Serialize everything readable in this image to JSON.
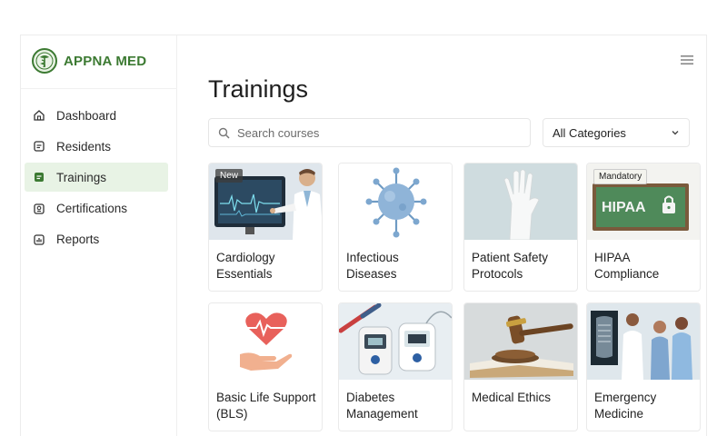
{
  "brand": {
    "name": "APPNA MED",
    "accent": "#3c7a32"
  },
  "sidebar": {
    "items": [
      {
        "label": "Dashboard",
        "icon": "home-icon",
        "active": false
      },
      {
        "label": "Residents",
        "icon": "id-card-icon",
        "active": false
      },
      {
        "label": "Trainings",
        "icon": "book-icon",
        "active": true
      },
      {
        "label": "Certifications",
        "icon": "certificate-icon",
        "active": false
      },
      {
        "label": "Reports",
        "icon": "chart-icon",
        "active": false
      }
    ]
  },
  "main": {
    "title": "Trainings",
    "search": {
      "placeholder": "Search courses",
      "value": ""
    },
    "category": {
      "selected": "All Categories"
    }
  },
  "courses": [
    {
      "title": "Cardiology Essentials",
      "badge": "New",
      "image": "doctor-pointing-at-ecg-monitor"
    },
    {
      "title": "Infectious Diseases",
      "badge": "",
      "image": "virus-particle"
    },
    {
      "title": "Patient Safety Protocols",
      "badge": "",
      "image": "gloved-hand"
    },
    {
      "title": "HIPAA Compliance",
      "badge": "Mandatory",
      "image": "hipaa-chalkboard-with-lock",
      "image_text": "HIPAA"
    },
    {
      "title": "Basic Life Support (BLS)",
      "badge": "",
      "image": "heart-in-hand"
    },
    {
      "title": "Diabetes Management",
      "badge": "",
      "image": "glucose-meters"
    },
    {
      "title": "Medical Ethics",
      "badge": "",
      "image": "gavel-on-book"
    },
    {
      "title": "Emergency Medicine",
      "badge": "",
      "image": "medical-staff-with-xray"
    }
  ]
}
